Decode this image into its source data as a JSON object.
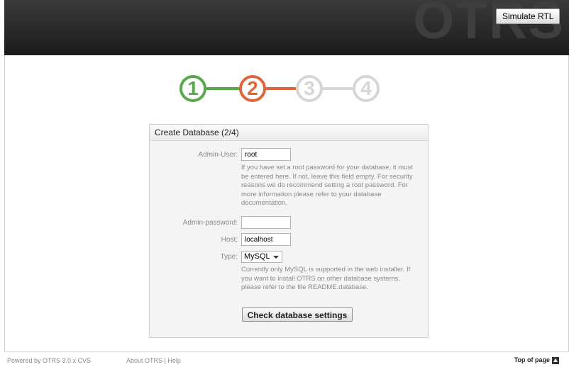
{
  "header": {
    "logo_text": "OTRS",
    "simulate_rtl_label": "Simulate RTL"
  },
  "steps": [
    {
      "label": "1",
      "state": "done",
      "color": "#5aa84c"
    },
    {
      "label": "2",
      "state": "current",
      "color": "#e0663a"
    },
    {
      "label": "3",
      "state": "pending",
      "color": "#d6d6d6"
    },
    {
      "label": "4",
      "state": "pending",
      "color": "#d6d6d6"
    }
  ],
  "form": {
    "title": "Create Database (2/4)",
    "admin_user_label": "Admin-User:",
    "admin_user_value": "root",
    "admin_user_help": "If you have set a root password for your database, it must be entered here. If not, leave this field empty. For security reasons we do recommend setting a root password. For more information please refer to your database documentation.",
    "admin_password_label": "Admin-password:",
    "admin_password_value": "",
    "host_label": "Host:",
    "host_value": "localhost",
    "type_label": "Type:",
    "type_value": "MySQL",
    "type_help": "Currently only MySQL is supported in the web installer. If you want to install OTRS on other database systems, please refer to the file README.database.",
    "check_button_label": "Check database settings"
  },
  "footer": {
    "powered_by": "Powered by OTRS 3.0.x CVS",
    "about_link": "About OTRS",
    "separator": "|",
    "help_link": "Help",
    "top_of_page": "Top of page"
  }
}
